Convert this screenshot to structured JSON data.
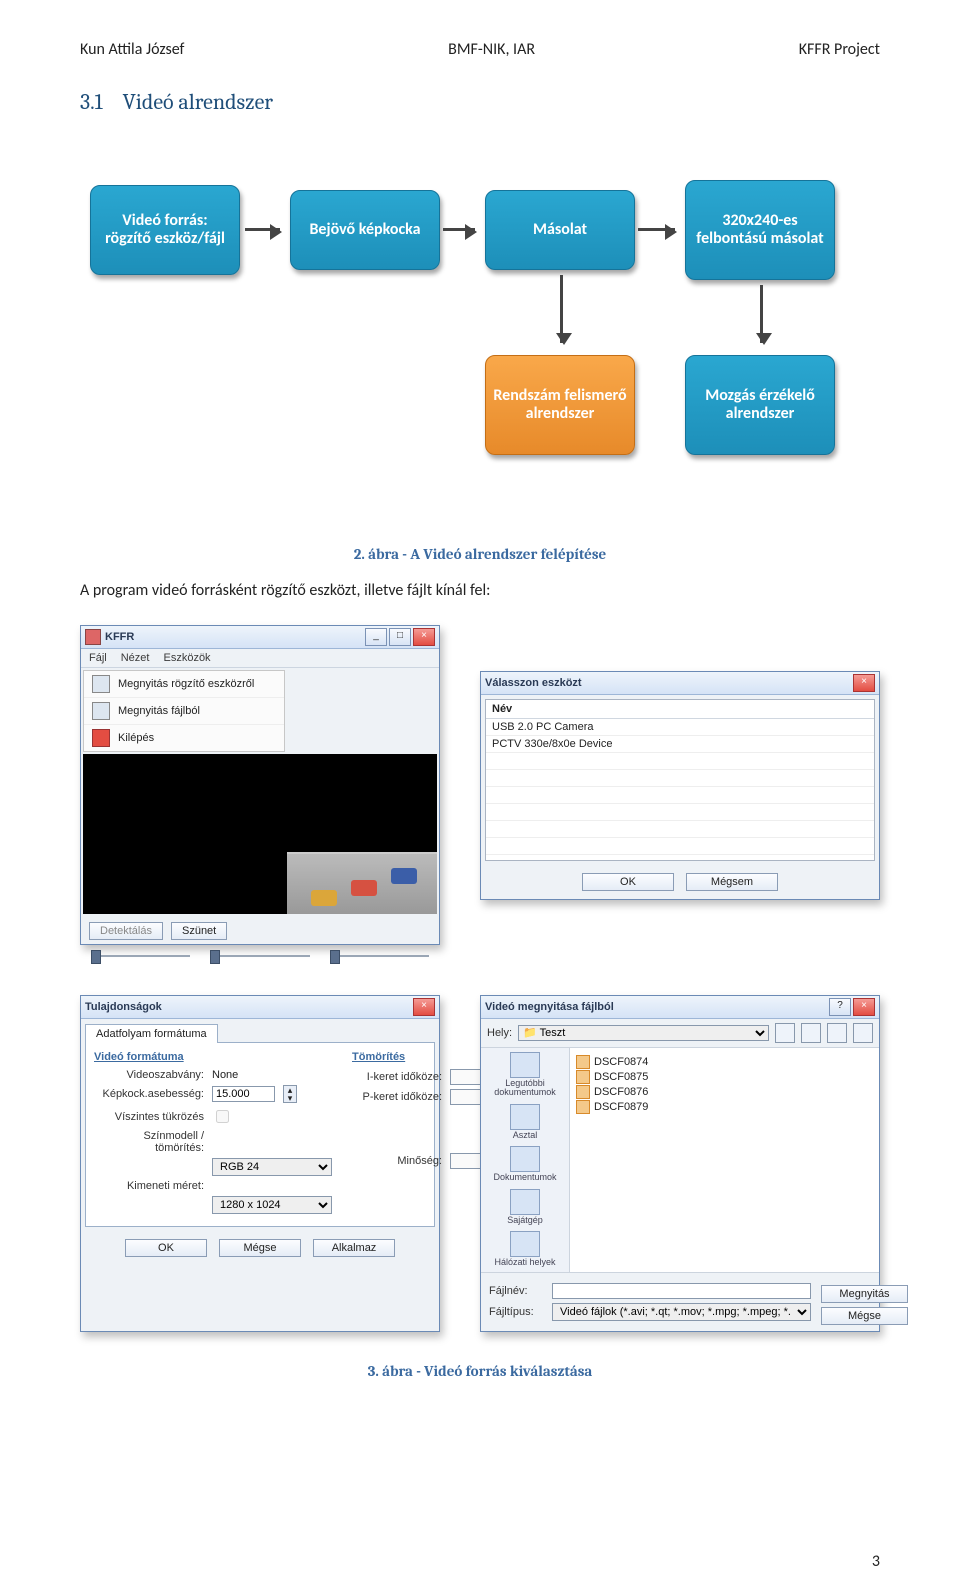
{
  "header": {
    "left": "Kun Attila József",
    "center": "BMF-NIK, IAR",
    "right": "KFFR Project"
  },
  "section": {
    "number": "3.1",
    "title": "Videó alrendszer"
  },
  "diagram": {
    "nodes": {
      "n1": "Videó forrás:\nrögzítő eszköz/fájl",
      "n2": "Bejövő képkocka",
      "n3": "Másolat",
      "n4": "320x240-es felbontású másolat",
      "n5": "Rendszám felismerő alrendszer",
      "n6": "Mozgás érzékelő alrendszer"
    }
  },
  "caption1": "2. ábra - A Videó alrendszer felépítése",
  "body": "A program videó forrásként rögzítő eszközt, illetve fájlt kínál fel:",
  "kffr_window": {
    "title": "KFFR",
    "menubar": [
      "Fájl",
      "Nézet",
      "Eszközök"
    ],
    "menu_items": [
      "Megnyitás rögzítő eszközről",
      "Megnyitás fájlból",
      "Kilépés"
    ],
    "buttons": {
      "detect": "Detektálás",
      "pause": "Szünet"
    }
  },
  "device_dialog": {
    "title": "Válasszon eszközt",
    "header": "Név",
    "devices": [
      "USB 2.0 PC Camera",
      "PCTV 330e/8x0e Device"
    ],
    "ok": "OK",
    "cancel": "Mégsem"
  },
  "properties_dialog": {
    "title": "Tulajdonságok",
    "tab": "Adatfolyam formátuma",
    "col1_header": "Videó formátuma",
    "col2_header": "Tömörítés",
    "labels": {
      "standard": "Videoszabvány:",
      "standard_val": "None",
      "fps": "Képkock.asebesség:",
      "fps_val": "15.000",
      "flip": "Víszintes tükrözés",
      "color": "Színmodell / tömörítés:",
      "color_val": "RGB 24",
      "size": "Kimeneti méret:",
      "size_val": "1280 x 1024",
      "ikey": "I-keret időköze:",
      "pkey": "P-keret időköze:",
      "quality": "Minőség:"
    },
    "ok": "OK",
    "cancel": "Mégse",
    "apply": "Alkalmaz"
  },
  "file_dialog": {
    "title": "Videó megnyitása fájlból",
    "location_label": "Hely:",
    "location_val": "Teszt",
    "places": [
      "Legutóbbi dokumentumok",
      "Asztal",
      "Dokumentumok",
      "Sajátgép",
      "Hálózati helyek"
    ],
    "files": [
      "DSCF0874",
      "DSCF0875",
      "DSCF0876",
      "DSCF0879"
    ],
    "filename_label": "Fájlnév:",
    "filetype_label": "Fájltípus:",
    "filetype_val": "Videó fájlok (*.avi; *.qt; *.mov; *.mpg; *.mpeg; *.",
    "open": "Megnyitás",
    "cancel": "Mégse"
  },
  "caption2": "3. ábra - Videó forrás kiválasztása",
  "page_number": "3"
}
